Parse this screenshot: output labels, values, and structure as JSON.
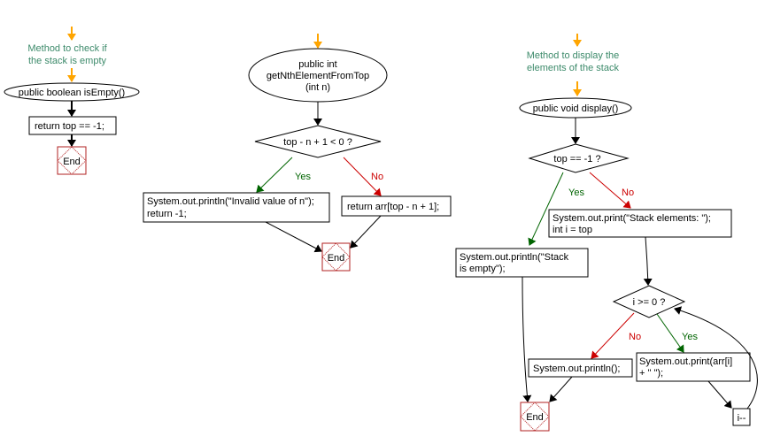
{
  "flow_isEmpty": {
    "comment": [
      "Method to check if",
      "the stack is empty"
    ],
    "start": "public boolean isEmpty()",
    "return": "return top == -1;",
    "end": "End"
  },
  "flow_getNth": {
    "start": [
      "public int",
      "getNthElementFromTop",
      "(int n)"
    ],
    "condition": "top - n + 1 < 0 ?",
    "yes_label": "Yes",
    "no_label": "No",
    "yes_action": [
      "System.out.println(\"Invalid value of n\");",
      "return -1;"
    ],
    "no_action": "return arr[top - n + 1];",
    "end": "End"
  },
  "flow_display": {
    "comment": [
      "Method to display the",
      "elements of the stack"
    ],
    "start": "public void display()",
    "condition": "top == -1 ?",
    "yes_label": "Yes",
    "no_label": "No",
    "yes_action": [
      "System.out.println(\"Stack",
      "is empty\");"
    ],
    "no_action": [
      "System.out.print(\"Stack elements: \");",
      "int i = top"
    ],
    "loop_condition": "i >= 0 ?",
    "loop_no_label": "No",
    "loop_yes_label": "Yes",
    "loop_no_action": "System.out.println();",
    "loop_yes_action": [
      "System.out.print(arr[i]",
      "+ \" \");"
    ],
    "decrement": "i--",
    "end": "End"
  },
  "colors": {
    "comment": "#3c8a6a",
    "yes": "#006400",
    "no": "#cc0000",
    "start_arrow": "#ffa500",
    "end_box": "#b22222"
  }
}
